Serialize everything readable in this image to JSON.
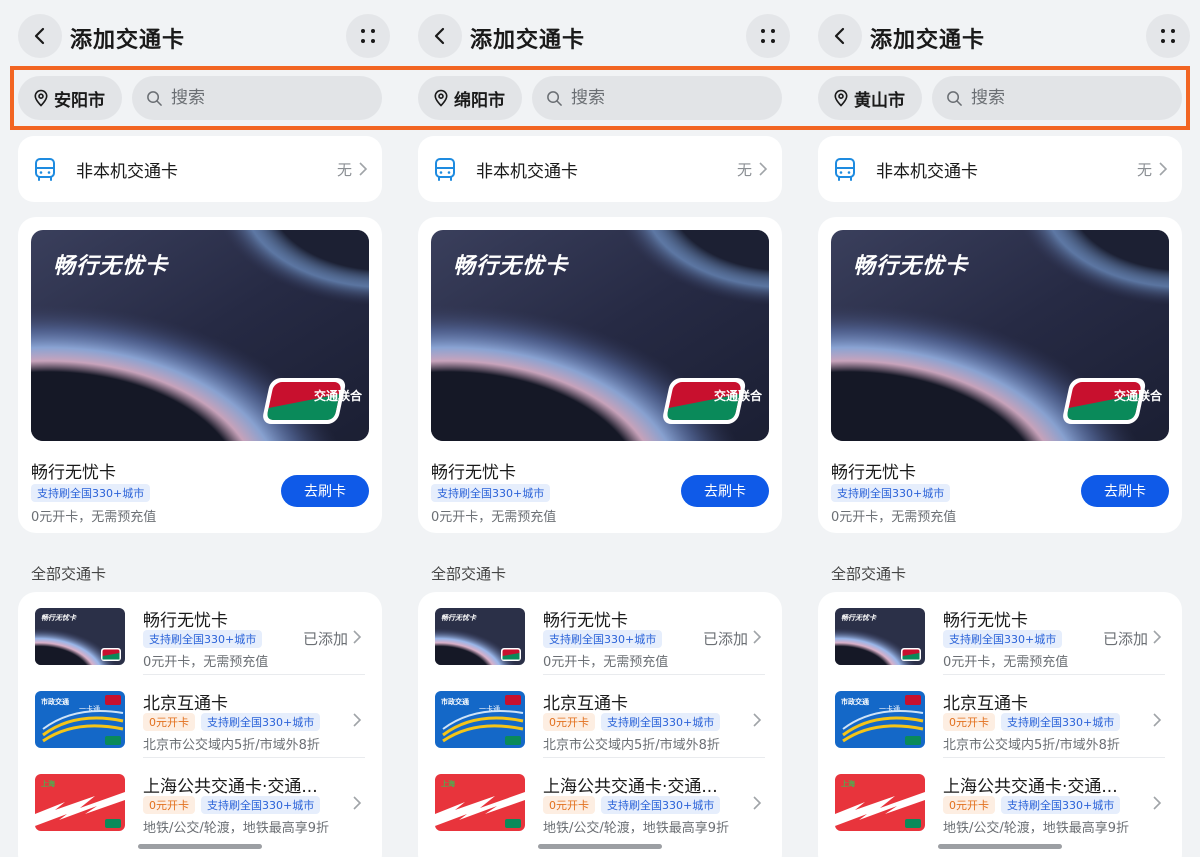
{
  "page": {
    "title": "添加交通卡"
  },
  "columns": [
    {
      "city": "安阳市"
    },
    {
      "city": "绵阳市"
    },
    {
      "city": "黄山市"
    }
  ],
  "search": {
    "placeholder": "搜索"
  },
  "non_local": {
    "label": "非本机交通卡",
    "value": "无"
  },
  "featured": {
    "art_title": "畅行无忧卡",
    "name": "畅行无忧卡",
    "badge": "支持刷全国330+城市",
    "desc": "0元开卡，无需预充值",
    "button": "去刷卡",
    "logo_text": "交通联合"
  },
  "section": {
    "title": "全部交通卡"
  },
  "cards": [
    {
      "name": "畅行无忧卡",
      "badges": [
        "支持刷全国330+城市"
      ],
      "orange_badge": "",
      "desc": "0元开卡，无需预充值",
      "status": "已添加"
    },
    {
      "name": "北京互通卡",
      "orange_badge": "0元开卡",
      "badges": [
        "支持刷全国330+城市"
      ],
      "desc": "北京市公交域内5折/市域外8折",
      "status": ""
    },
    {
      "name": "上海公共交通卡·交通...",
      "orange_badge": "0元开卡",
      "badges": [
        "支持刷全国330+城市"
      ],
      "desc": "地铁/公交/轮渡，地铁最高享9折",
      "status": ""
    }
  ],
  "colors": {
    "accent": "#0f5ae8",
    "highlight": "#f26522",
    "badge_blue": "#2a62d8",
    "badge_orange": "#e2711f"
  }
}
